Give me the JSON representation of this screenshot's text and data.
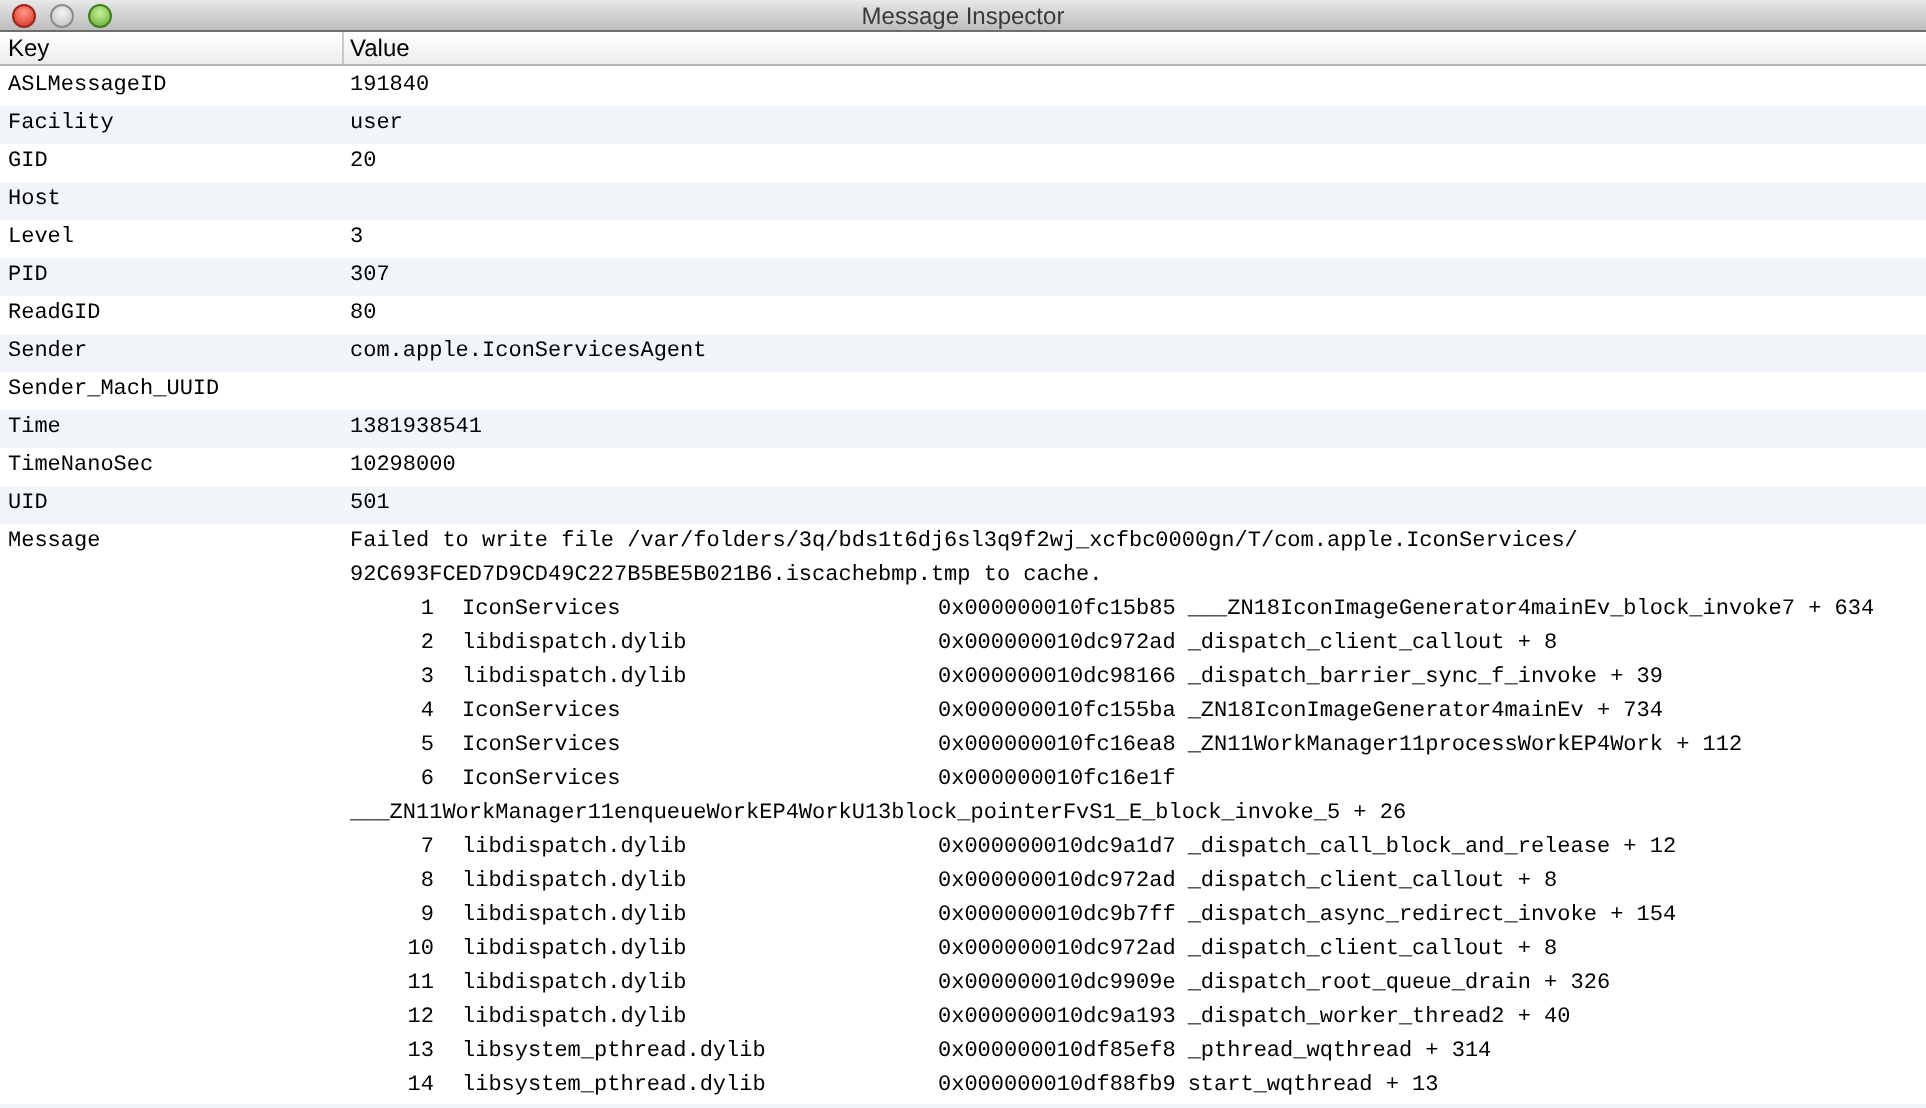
{
  "window": {
    "title": "Message Inspector"
  },
  "table": {
    "columns": [
      "Key",
      "Value"
    ],
    "rows": [
      {
        "key": "ASLMessageID",
        "value": "191840"
      },
      {
        "key": "Facility",
        "value": "user"
      },
      {
        "key": "GID",
        "value": "20"
      },
      {
        "key": "Host",
        "value": ""
      },
      {
        "key": "Level",
        "value": "3"
      },
      {
        "key": "PID",
        "value": "307"
      },
      {
        "key": "ReadGID",
        "value": "80"
      },
      {
        "key": "Sender",
        "value": "com.apple.IconServicesAgent"
      },
      {
        "key": "Sender_Mach_UUID",
        "value": ""
      },
      {
        "key": "Time",
        "value": "1381938541"
      },
      {
        "key": "TimeNanoSec",
        "value": "10298000"
      },
      {
        "key": "UID",
        "value": "501"
      }
    ],
    "message": {
      "key": "Message",
      "lines": [
        {
          "kind": "text",
          "text": "Failed to write file /var/folders/3q/bds1t6dj6sl3q9f2wj_xcfbc0000gn/T/com.apple.IconServices/"
        },
        {
          "kind": "text",
          "text": "92C693FCED7D9CD49C227B5BE5B021B6.iscachebmp.tmp to cache."
        },
        {
          "kind": "frame",
          "number": "1",
          "library": "IconServices",
          "address": "0x000000010fc15b85",
          "symbol": "___ZN18IconImageGenerator4mainEv_block_invoke7 + 634"
        },
        {
          "kind": "frame",
          "number": "2",
          "library": "libdispatch.dylib",
          "address": "0x000000010dc972ad",
          "symbol": "_dispatch_client_callout + 8"
        },
        {
          "kind": "frame",
          "number": "3",
          "library": "libdispatch.dylib",
          "address": "0x000000010dc98166",
          "symbol": "_dispatch_barrier_sync_f_invoke + 39"
        },
        {
          "kind": "frame",
          "number": "4",
          "library": "IconServices",
          "address": "0x000000010fc155ba",
          "symbol": "_ZN18IconImageGenerator4mainEv + 734"
        },
        {
          "kind": "frame",
          "number": "5",
          "library": "IconServices",
          "address": "0x000000010fc16ea8",
          "symbol": "_ZN11WorkManager11processWorkEP4Work + 112"
        },
        {
          "kind": "frame",
          "number": "6",
          "library": "IconServices",
          "address": "0x000000010fc16e1f"
        },
        {
          "kind": "text",
          "text": "___ZN11WorkManager11enqueueWorkEP4WorkU13block_pointerFvS1_E_block_invoke_5 + 26"
        },
        {
          "kind": "frame",
          "number": "7",
          "library": "libdispatch.dylib",
          "address": "0x000000010dc9a1d7",
          "symbol": "_dispatch_call_block_and_release + 12"
        },
        {
          "kind": "frame",
          "number": "8",
          "library": "libdispatch.dylib",
          "address": "0x000000010dc972ad",
          "symbol": "_dispatch_client_callout + 8"
        },
        {
          "kind": "frame",
          "number": "9",
          "library": "libdispatch.dylib",
          "address": "0x000000010dc9b7ff",
          "symbol": "_dispatch_async_redirect_invoke + 154"
        },
        {
          "kind": "frame",
          "number": "10",
          "library": "libdispatch.dylib",
          "address": "0x000000010dc972ad",
          "symbol": "_dispatch_client_callout + 8"
        },
        {
          "kind": "frame",
          "number": "11",
          "library": "libdispatch.dylib",
          "address": "0x000000010dc9909e",
          "symbol": "_dispatch_root_queue_drain + 326"
        },
        {
          "kind": "frame",
          "number": "12",
          "library": "libdispatch.dylib",
          "address": "0x000000010dc9a193",
          "symbol": "_dispatch_worker_thread2 + 40"
        },
        {
          "kind": "frame",
          "number": "13",
          "library": "libsystem_pthread.dylib",
          "address": "0x000000010df85ef8",
          "symbol": "_pthread_wqthread + 314"
        },
        {
          "kind": "frame",
          "number": "14",
          "library": "libsystem_pthread.dylib",
          "address": "0x000000010df88fb9",
          "symbol": "start_wqthread + 13"
        }
      ]
    }
  }
}
